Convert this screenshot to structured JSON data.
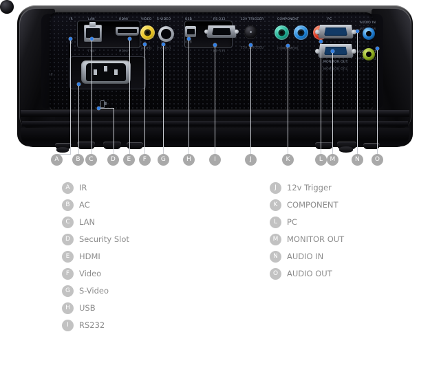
{
  "image": {
    "subject": "projector rear connector panel",
    "view": "rear panel with lettered callouts"
  },
  "panel_labels": [
    {
      "id": "IR",
      "text": "IR"
    },
    {
      "id": "LAN",
      "text": "LAN"
    },
    {
      "id": "HDMI",
      "text": "HDMI"
    },
    {
      "id": "VIDEO",
      "text": "VIDEO"
    },
    {
      "id": "S-VIDEO",
      "text": "S-VIDEO"
    },
    {
      "id": "USB",
      "text": "USB"
    },
    {
      "id": "RS-232",
      "text": "RS-232"
    },
    {
      "id": "12V TRIGGER",
      "text": "12V TRIGGER"
    },
    {
      "id": "COMPONENT",
      "text": "COMPONENT"
    },
    {
      "id": "PC",
      "text": "PC"
    },
    {
      "id": "MONITOR OUT",
      "text": "MONITOR OUT"
    },
    {
      "id": "AUDIO IN",
      "text": "AUDIO IN"
    },
    {
      "id": "AUDIO OUT",
      "text": "AUDIO OUT"
    }
  ],
  "markers": [
    {
      "letter": "A"
    },
    {
      "letter": "B"
    },
    {
      "letter": "C"
    },
    {
      "letter": "D"
    },
    {
      "letter": "E"
    },
    {
      "letter": "F"
    },
    {
      "letter": "G"
    },
    {
      "letter": "H"
    },
    {
      "letter": "I"
    },
    {
      "letter": "J"
    },
    {
      "letter": "K"
    },
    {
      "letter": "L"
    },
    {
      "letter": "M"
    },
    {
      "letter": "N"
    },
    {
      "letter": "O"
    }
  ],
  "legend": {
    "column_left": [
      {
        "letter": "A",
        "label": "IR"
      },
      {
        "letter": "B",
        "label": "AC"
      },
      {
        "letter": "C",
        "label": "LAN"
      },
      {
        "letter": "D",
        "label": "Security Slot"
      },
      {
        "letter": "E",
        "label": "HDMI"
      },
      {
        "letter": "F",
        "label": "Video"
      },
      {
        "letter": "G",
        "label": "S-Video"
      },
      {
        "letter": "H",
        "label": "USB"
      },
      {
        "letter": "I",
        "label": "RS232"
      }
    ],
    "column_right": [
      {
        "letter": "J",
        "label": "12v Trigger"
      },
      {
        "letter": "K",
        "label": "COMPONENT"
      },
      {
        "letter": "L",
        "label": "PC"
      },
      {
        "letter": "M",
        "label": "MONITOR OUT"
      },
      {
        "letter": "N",
        "label": "AUDIO IN"
      },
      {
        "letter": "O",
        "label": "AUDIO OUT"
      }
    ]
  },
  "colors": {
    "background": "#ffffff",
    "marker_fill": "#a9a9a9",
    "legend_marker_fill": "#c2c2c2",
    "legend_text": "#8c8c8c",
    "callout_dot": "#2f7fe8",
    "leader_line": "#c9ccd2",
    "chassis": "#060607",
    "video_jack": "#e8c21e",
    "component_green": "#1aa88d",
    "component_blue": "#1a7fd4",
    "component_red": "#d42a15",
    "audio_in_jack": "#1b79cf",
    "audio_out_jack": "#8aa81c",
    "vga_connector": "#123a66"
  }
}
